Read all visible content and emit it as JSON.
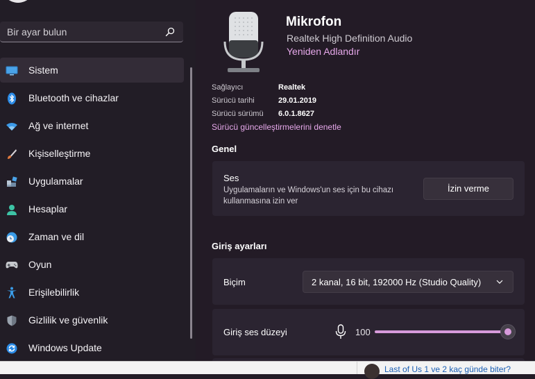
{
  "search": {
    "placeholder": "Bir ayar bulun"
  },
  "nav": [
    {
      "label": "Sistem",
      "icon": "display-icon",
      "active": true
    },
    {
      "label": "Bluetooth ve cihazlar",
      "icon": "bluetooth-icon"
    },
    {
      "label": "Ağ ve internet",
      "icon": "wifi-icon"
    },
    {
      "label": "Kişiselleştirme",
      "icon": "brush-icon"
    },
    {
      "label": "Uygulamalar",
      "icon": "apps-icon"
    },
    {
      "label": "Hesaplar",
      "icon": "person-icon"
    },
    {
      "label": "Zaman ve dil",
      "icon": "globe-clock-icon"
    },
    {
      "label": "Oyun",
      "icon": "gamepad-icon"
    },
    {
      "label": "Erişilebilirlik",
      "icon": "accessibility-icon"
    },
    {
      "label": "Gizlilik ve güvenlik",
      "icon": "shield-icon"
    },
    {
      "label": "Windows Update",
      "icon": "update-icon"
    }
  ],
  "device": {
    "name": "Mikrofon",
    "subtitle": "Realtek High Definition Audio",
    "rename": "Yeniden Adlandır",
    "icon": "microphone-icon"
  },
  "driver_info": [
    {
      "label": "Sağlayıcı",
      "value": "Realtek"
    },
    {
      "label": "Sürücü tarihi",
      "value": "29.01.2019"
    },
    {
      "label": "Sürücü sürümü",
      "value": "6.0.1.8627"
    }
  ],
  "driver_update_link": "Sürücü güncelleştirmelerini denetle",
  "general": {
    "title": "Genel",
    "audio": {
      "title": "Ses",
      "desc": "Uygulamaların ve Windows'un ses için bu cihazı kullanmasına izin ver",
      "button": "İzin verme"
    }
  },
  "input_settings": {
    "title": "Giriş ayarları",
    "format": {
      "label": "Biçim",
      "selected": "2 kanal, 16 bit, 192000 Hz (Studio Quality)"
    },
    "volume": {
      "label": "Giriş ses düzeyi",
      "value": "100",
      "level_percent": 100
    }
  },
  "bottom_bar": {
    "text": "Last of Us 1 ve 2 kaç günde biter?"
  },
  "colors": {
    "accent": "#d79adb",
    "link": "#e6a8ea",
    "background": "#221c26",
    "card": "#2b2431"
  }
}
